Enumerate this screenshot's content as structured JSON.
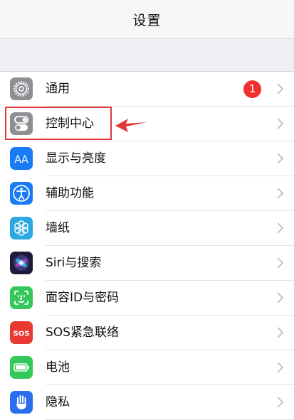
{
  "nav": {
    "title": "设置"
  },
  "badge_color": "#f0302c",
  "annotation_color": "#e2383a",
  "rows": [
    {
      "label": "通用",
      "icon": "gear-icon",
      "color": "#8e8e93",
      "badge": "1"
    },
    {
      "label": "控制中心",
      "icon": "toggle-switches-icon",
      "color": "#8e8e93"
    },
    {
      "label": "显示与亮度",
      "icon": "text-size-icon",
      "color": "#1a7cf5",
      "icon_text": "AA"
    },
    {
      "label": "辅助功能",
      "icon": "accessibility-icon",
      "color": "#1a7cf5"
    },
    {
      "label": "墙纸",
      "icon": "flower-icon",
      "color": "#2ba8e0"
    },
    {
      "label": "Siri与搜索",
      "icon": "siri-icon",
      "color": "#1c1c3a"
    },
    {
      "label": "面容ID与密码",
      "icon": "face-id-icon",
      "color": "#34c759"
    },
    {
      "label": "SOS紧急联络",
      "icon": "sos-icon",
      "color": "#e83a32",
      "icon_text": "SOS"
    },
    {
      "label": "电池",
      "icon": "battery-icon",
      "color": "#34c759"
    },
    {
      "label": "隐私",
      "icon": "hand-icon",
      "color": "#2a6ef0"
    }
  ]
}
